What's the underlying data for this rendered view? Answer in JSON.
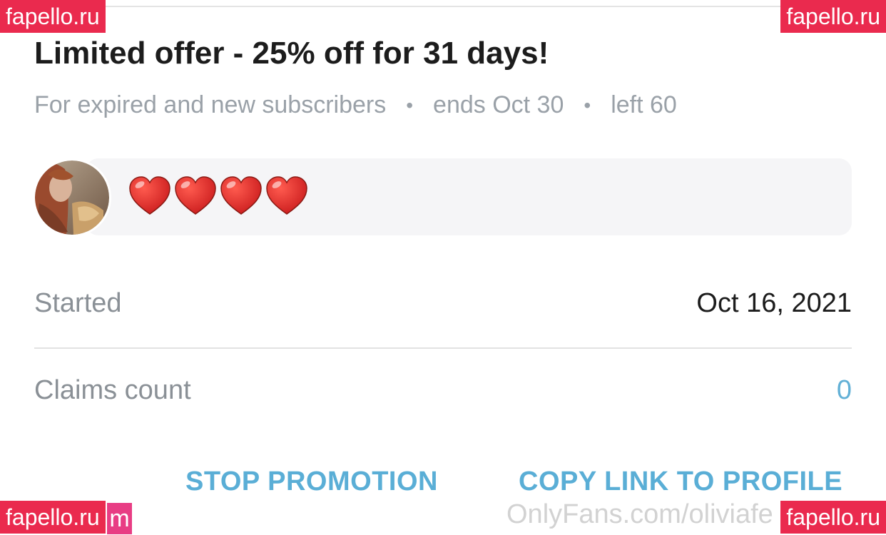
{
  "offer": {
    "title": "Limited offer - 25% off for 31 days!",
    "audience": "For expired and new subscribers",
    "ends": "ends Oct 30",
    "left": "left 60",
    "separator": "•"
  },
  "message": {
    "hearts_count": 4,
    "heart_icon": "red-heart-emoji"
  },
  "details": {
    "started_label": "Started",
    "started_value": "Oct 16, 2021",
    "claims_label": "Claims count",
    "claims_value": "0"
  },
  "actions": {
    "stop_label": "STOP PROMOTION",
    "copy_label": "COPY LINK TO PROFILE"
  },
  "watermark": {
    "site_text": "OnlyFans.com/oliviafe",
    "badge_text": "fapello.ru",
    "pink_fragment": "m"
  },
  "colors": {
    "accent": "#5aaed6",
    "badge": "#ea2a4e",
    "muted": "#9aa1a8"
  }
}
